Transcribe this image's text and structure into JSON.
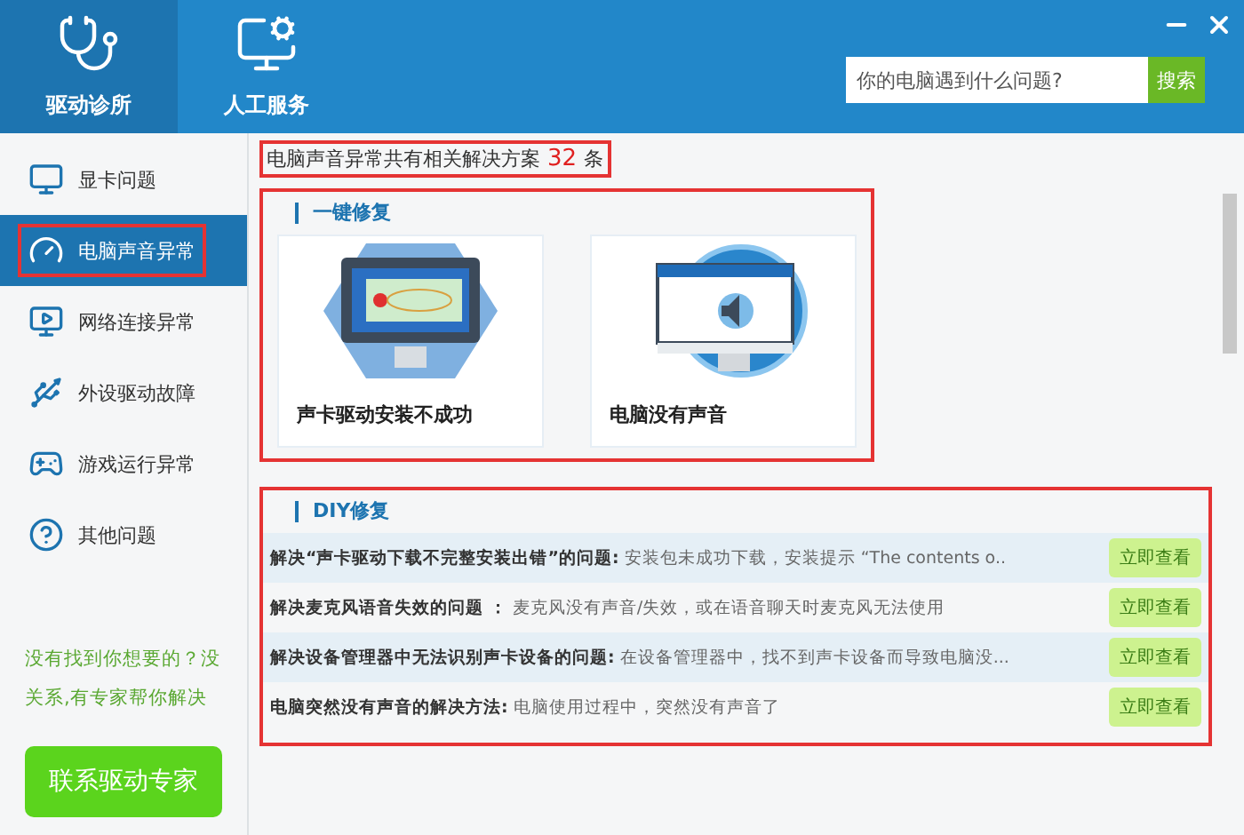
{
  "header": {
    "tabs": [
      {
        "label": "驱动诊所",
        "selected": true
      },
      {
        "label": "人工服务",
        "selected": false
      }
    ],
    "search": {
      "placeholder": "你的电脑遇到什么问题?",
      "button": "搜索"
    }
  },
  "sidebar": {
    "items": [
      {
        "label": "显卡问题",
        "selected": false,
        "highlighted": false
      },
      {
        "label": "电脑声音异常",
        "selected": true,
        "highlighted": true
      },
      {
        "label": "网络连接异常",
        "selected": false,
        "highlighted": false
      },
      {
        "label": "外设驱动故障",
        "selected": false,
        "highlighted": false
      },
      {
        "label": "游戏运行异常",
        "selected": false,
        "highlighted": false
      },
      {
        "label": "其他问题",
        "selected": false,
        "highlighted": false
      }
    ],
    "help_text": "没有找到你想要的？没关系,有专家帮你解决",
    "contact_button": "联系驱动专家"
  },
  "summary": {
    "text": "电脑声音异常共有相关解决方案",
    "count": "32",
    "unit": "条",
    "highlighted": true
  },
  "one_click": {
    "title": "一键修复",
    "highlighted": true,
    "cards": [
      {
        "caption": "声卡驱动安装不成功"
      },
      {
        "caption": "电脑没有声音"
      }
    ]
  },
  "diy": {
    "title": "DIY修复",
    "highlighted": true,
    "rows": [
      {
        "title": "解决“声卡驱动下载不完整安装出错”的问题:",
        "desc": "安装包未成功下载，安装提示 “The contents o..",
        "button": "立即查看"
      },
      {
        "title": "解决麦克风语音失效的问题  ：",
        "desc": "麦克风没有声音/失效，或在语音聊天时麦克风无法使用",
        "button": "立即查看"
      },
      {
        "title": "解决设备管理器中无法识别声卡设备的问题:",
        "desc": "在设备管理器中，找不到声卡设备而导致电脑没...",
        "button": "立即查看"
      },
      {
        "title": "电脑突然没有声音的解决方法:",
        "desc": "电脑使用过程中，突然没有声音了",
        "button": "立即查看"
      }
    ]
  }
}
